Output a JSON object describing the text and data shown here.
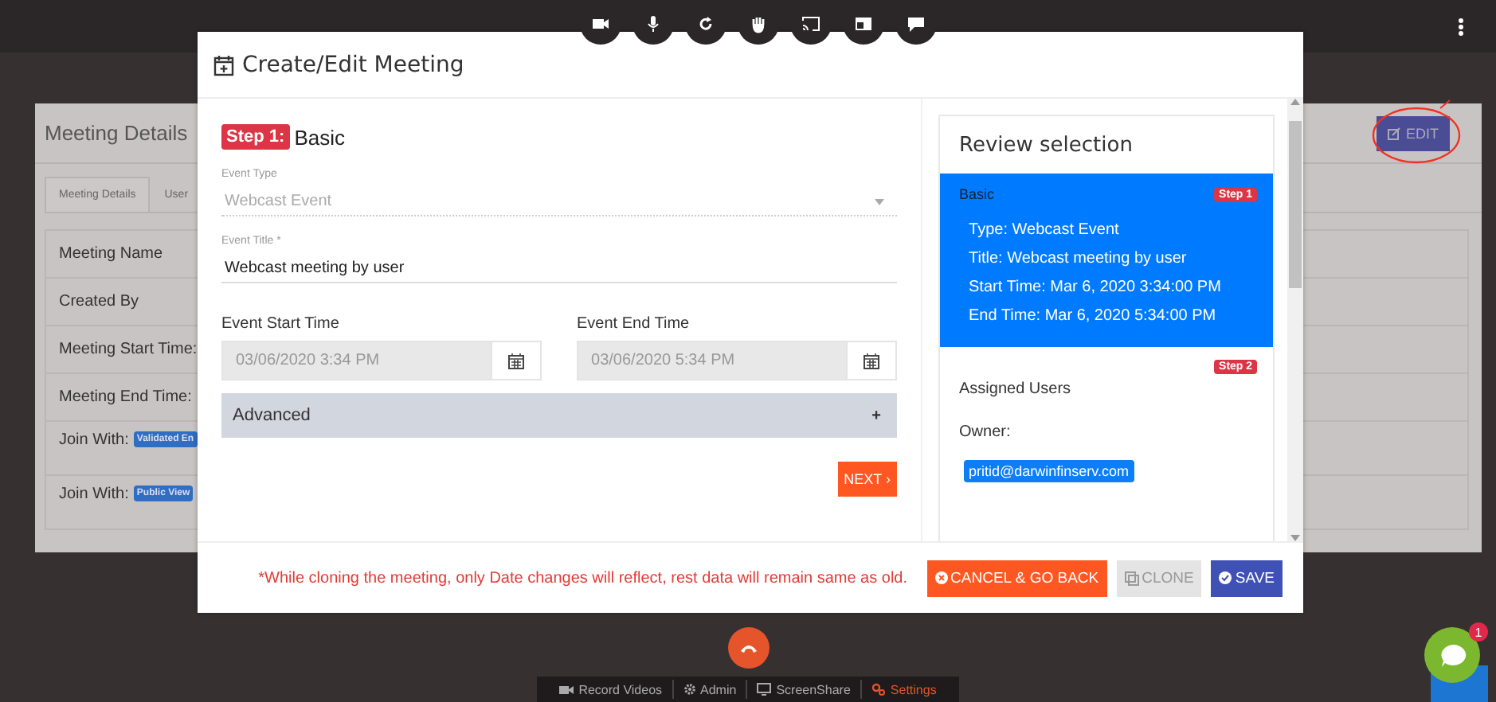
{
  "details": {
    "title": "Meeting Details",
    "edit_button": "EDIT",
    "tabs": [
      {
        "label": "Meeting Details",
        "selected": true
      },
      {
        "label": "User",
        "selected": false
      }
    ],
    "rows": [
      {
        "label": "Meeting Name"
      },
      {
        "label": "Created By"
      },
      {
        "label": "Meeting Start Time:"
      },
      {
        "label": "Meeting End Time:"
      },
      {
        "label": "Join With:",
        "badge": "Validated En"
      },
      {
        "label": "Join With:",
        "badge": "Public View"
      }
    ]
  },
  "modal": {
    "title": "Create/Edit Meeting",
    "step": {
      "badge": "Step 1:",
      "title": "Basic"
    },
    "fields": [
      {
        "kind": "select",
        "label": "Event Type",
        "value": "Webcast Event",
        "disabled": true
      },
      {
        "kind": "text",
        "label": "Event Title *",
        "value": "Webcast meeting by user",
        "disabled": false
      }
    ],
    "times": [
      {
        "label": "Event Start Time",
        "value": "03/06/2020 3:34 PM",
        "disabled": true
      },
      {
        "label": "Event End Time",
        "value": "03/06/2020 5:34 PM",
        "disabled": true
      }
    ],
    "advanced": {
      "label": "Advanced",
      "toggle": "+"
    },
    "next_button": "NEXT ›",
    "review": {
      "title": "Review selection",
      "sections": [
        {
          "kind": "basic",
          "title": "Basic",
          "badge": "Step 1",
          "selected": true,
          "lines": [
            "Type: Webcast Event",
            "Title: Webcast meeting by user",
            "Start Time: Mar 6, 2020 3:34:00 PM",
            "End Time: Mar 6, 2020 5:34:00 PM"
          ]
        },
        {
          "kind": "users",
          "title": "Assigned Users",
          "badge": "Step 2",
          "selected": false,
          "owner_label": "Owner:",
          "owners": [
            "pritid@darwinfinserv.com"
          ]
        }
      ]
    },
    "note": "*While cloning the meeting, only Date changes will reflect, rest data will remain same as old.",
    "buttons": [
      {
        "kind": "cancel",
        "label": "CANCEL & GO BACK",
        "disabled": false
      },
      {
        "kind": "clone",
        "label": "CLONE",
        "disabled": true
      },
      {
        "kind": "save",
        "label": "SAVE",
        "disabled": false
      }
    ]
  },
  "call_bar": {
    "items": [
      {
        "kind": "record",
        "label": "Record Videos",
        "active": false
      },
      {
        "kind": "admin",
        "label": "Admin",
        "active": false
      },
      {
        "kind": "screen",
        "label": "ScreenShare",
        "active": false
      },
      {
        "kind": "settings",
        "label": "Settings",
        "active": true
      }
    ]
  },
  "chat": {
    "badge": "1"
  }
}
